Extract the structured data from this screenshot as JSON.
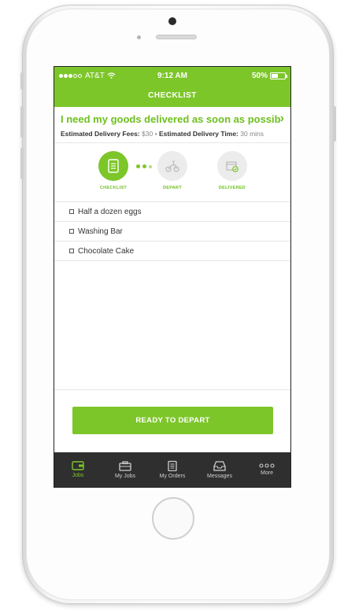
{
  "status_bar": {
    "carrier": "AT&T",
    "time": "9:12 AM",
    "battery": "50%"
  },
  "header": {
    "title": "CHECKLIST"
  },
  "job": {
    "title": "I need my goods delivered as soon as possible...",
    "fee_label": "Estimated Delivery Fees:",
    "fee_value": "$30",
    "separator": "•",
    "time_label": "Estimated Delivery Time:",
    "time_value": "30 mins"
  },
  "steps": [
    {
      "label": "CHECKLIST",
      "icon": "checklist-icon",
      "state": "active"
    },
    {
      "label": "DEPART",
      "icon": "scooter-icon",
      "state": "idle"
    },
    {
      "label": "DELIVERED",
      "icon": "delivered-box-icon",
      "state": "idle"
    }
  ],
  "checklist": [
    {
      "label": "Half a dozen eggs",
      "checked": false
    },
    {
      "label": "Washing Bar",
      "checked": false
    },
    {
      "label": "Chocolate Cake",
      "checked": false
    }
  ],
  "action": {
    "label": "READY TO DEPART"
  },
  "tabs": [
    {
      "label": "Jobs",
      "icon": "wallet-icon",
      "active": true
    },
    {
      "label": "My Jobs",
      "icon": "briefcase-icon",
      "active": false
    },
    {
      "label": "My Orders",
      "icon": "clipboard-icon",
      "active": false
    },
    {
      "label": "Messages",
      "icon": "inbox-icon",
      "active": false
    },
    {
      "label": "More",
      "icon": "more-dots-icon",
      "active": false
    }
  ],
  "colors": {
    "accent": "#7dc62a",
    "tabbar": "#2f2f2f"
  }
}
